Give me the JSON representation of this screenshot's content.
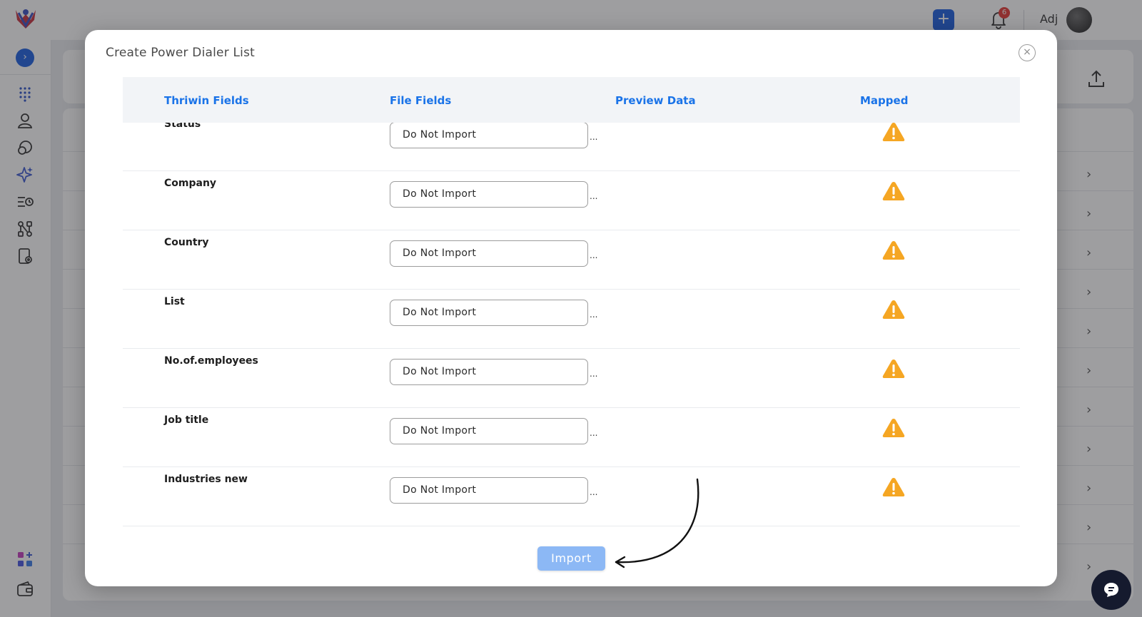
{
  "header": {
    "user_name": "Adj",
    "notification_count": "6",
    "add_label": "+"
  },
  "modal": {
    "title": "Create Power Dialer List",
    "close_label": "×",
    "columns": [
      "Thriwin Fields",
      "File Fields",
      "Preview Data",
      "Mapped"
    ],
    "rows": [
      {
        "field": "Status",
        "mapping": "Do Not Import",
        "preview": "",
        "mapped": "warning-icon"
      },
      {
        "field": "Company",
        "mapping": "Do Not Import",
        "preview": "",
        "mapped": "warning-icon"
      },
      {
        "field": "Country",
        "mapping": "Do Not Import",
        "preview": "",
        "mapped": "warning-icon"
      },
      {
        "field": "List",
        "mapping": "Do Not Import",
        "preview": "",
        "mapped": "warning-icon"
      },
      {
        "field": "No.of.employees",
        "mapping": "Do Not Import",
        "preview": "",
        "mapped": "warning-icon"
      },
      {
        "field": "Job title",
        "mapping": "Do Not Import",
        "preview": "",
        "mapped": "warning-icon"
      },
      {
        "field": "Industries new",
        "mapping": "Do Not Import",
        "preview": "",
        "mapped": "warning-icon"
      }
    ],
    "truncation_marker": "...",
    "import_label": "Import"
  },
  "sidebar": {
    "icons": [
      "dialpad-icon",
      "contact-icon",
      "conversation-icon",
      "sparkle-icon",
      "queue-icon",
      "workflow-icon",
      "tablet-settings-icon",
      "apps-add-icon",
      "wallet-icon"
    ]
  },
  "colors": {
    "accent": "#1a73e8",
    "brand_blue": "#1d5fe0",
    "warning": "#f5a623",
    "import_disabled": "#8cb8f5"
  }
}
